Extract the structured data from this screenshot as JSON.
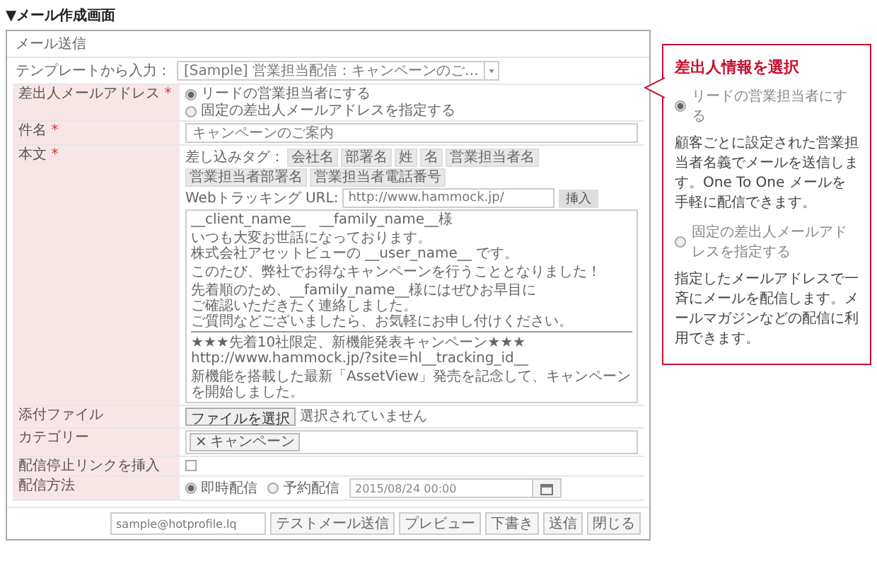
{
  "page_title": "▼メール作成画面",
  "dialog": {
    "title": "メール送信",
    "template": {
      "label": "テンプレートから入力：",
      "value": "[Sample] 営業担当配信：キャンペーンのご…"
    },
    "fields": [
      {
        "kind": "radios",
        "label": "差出人メールアドレス",
        "required_mark": "*",
        "options": [
          {
            "label": "リードの営業担当者にする",
            "selected": true
          },
          {
            "label": "固定の差出人メールアドレスを指定する",
            "selected": false
          }
        ]
      },
      {
        "kind": "text",
        "label": "件名",
        "required_mark": "*",
        "value": "キャンペーンのご案内"
      },
      {
        "kind": "body",
        "label": "本文",
        "required_mark": "*",
        "tags_label": "差し込みタグ：",
        "tags": [
          "会社名",
          "部署名",
          "姓",
          "名",
          "営業担当者名",
          "営業担当者部署名",
          "営業担当者電話番号"
        ],
        "url_label": "Webトラッキング URL:",
        "url_value": "http://www.hammock.jp/",
        "url_button": "挿入",
        "paragraphs": [
          {
            "lines": [
              "__client_name__　__family_name__様"
            ]
          },
          {
            "lines": [
              "いつも大変お世話になっております。",
              "株式会社アセットビューの __user_name__ です。"
            ]
          },
          {
            "lines": [
              "このたび、弊社でお得なキャンペーンを行うこととなりました！"
            ]
          },
          {
            "lines": [
              "先着順のため、__family_name__様にはぜひお早目に",
              "ご確認いただきたく連絡しました。",
              "ご質問などございましたら、お気軽にお申し付けください。"
            ],
            "rule_below": true
          },
          {
            "lines": [
              "★★★先着10社限定、新機能発表キャンペーン★★★",
              "http://www.hammock.jp/?site=hl__tracking_id__"
            ]
          },
          {
            "lines": [
              "新機能を搭載した最新「AssetView」発売を記念して、キャンペーン",
              "を開始しました。"
            ]
          }
        ]
      },
      {
        "kind": "file",
        "label": "添付ファイル",
        "button": "ファイルを選択",
        "value": "選択されていません"
      },
      {
        "kind": "tags",
        "label": "カテゴリー",
        "tags": [
          {
            "remove": "×",
            "label": "キャンペーン"
          }
        ]
      },
      {
        "kind": "checkbox",
        "label": "配信停止リンクを挿入",
        "checked": false
      },
      {
        "kind": "schedule",
        "label": "配信方法",
        "options": [
          {
            "label": "即時配信",
            "selected": true
          },
          {
            "label": "予約配信",
            "selected": false
          }
        ],
        "date": "2015/08/24 00:00"
      }
    ],
    "footer": {
      "test_address": "sample@hotprofile.lq",
      "buttons": [
        "テストメール送信",
        "プレビュー",
        "下書き",
        "送信",
        "閉じる"
      ]
    }
  },
  "callout": {
    "title": "差出人情報を選択",
    "options": [
      {
        "label": "リードの営業担当者にする",
        "selected": true,
        "description": "顧客ごとに設定された営業担当者名義でメールを送信します。One To One メールを手軽に配信できます。"
      },
      {
        "label": "固定の差出人メールアドレスを指定する",
        "selected": false,
        "description": "指定したメールアドレスで一斉にメールを配信します。メールマガジンなどの配信に利用できます。"
      }
    ]
  }
}
